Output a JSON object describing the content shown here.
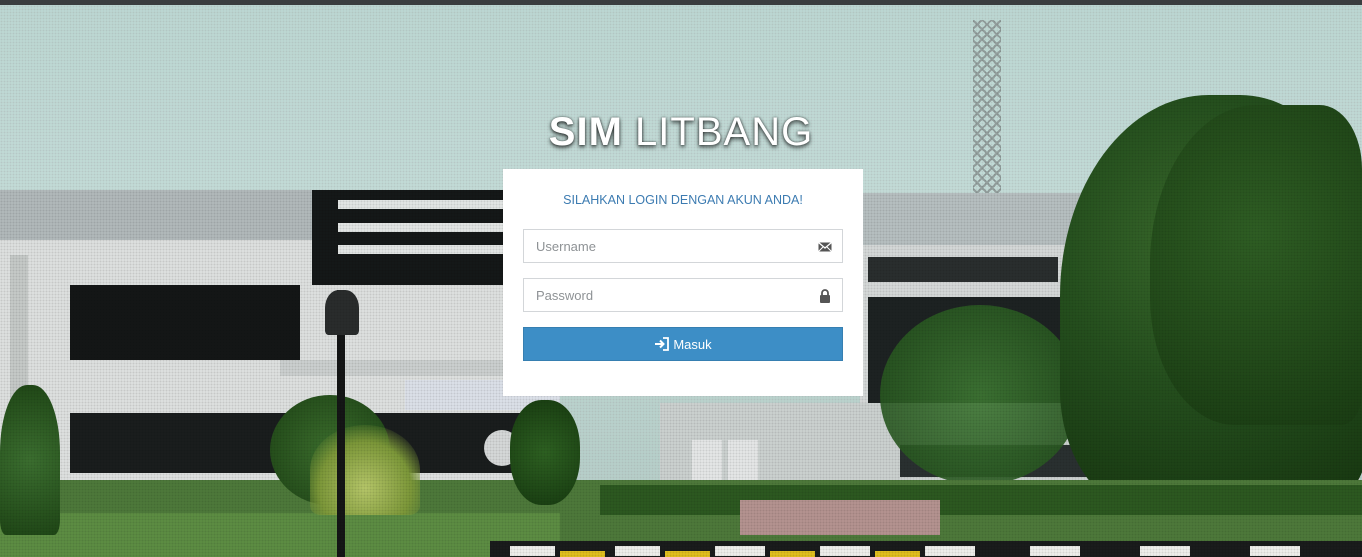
{
  "brand": {
    "bold": "SIM",
    "light": "LITBANG"
  },
  "login": {
    "heading": "SILAHKAN LOGIN DENGAN AKUN ANDA!",
    "username_placeholder": "Username",
    "username_icon": "envelope-icon",
    "password_placeholder": "Password",
    "password_icon": "lock-icon",
    "submit_label": "Masuk",
    "submit_icon": "sign-in-icon"
  },
  "colors": {
    "accent": "#3d8ec6",
    "heading_text": "#3c7bb1",
    "card_bg": "#ffffff",
    "top_bar": "#3a3d3f"
  }
}
